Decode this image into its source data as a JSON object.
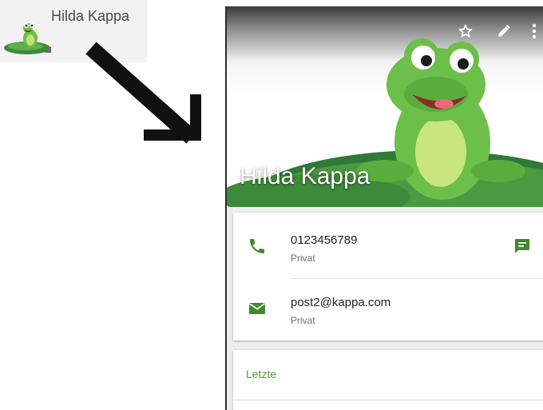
{
  "list_item": {
    "name": "Hilda Kappa",
    "avatar": "frog-avatar"
  },
  "annotation": {
    "arrow": "arrow-down-right-icon"
  },
  "contact": {
    "name": "Hilda Kappa",
    "toolbar": {
      "star": "star-outline-icon",
      "edit": "pencil-icon",
      "more": "more-vert-icon"
    },
    "phone": {
      "number": "0123456789",
      "label": "Privat",
      "icon": "phone-icon",
      "action_icon": "message-icon"
    },
    "email": {
      "address": "post2@kappa.com",
      "label": "Privat",
      "icon": "email-icon"
    },
    "recent": {
      "title": "Letzte"
    }
  },
  "colors": {
    "accent": "#5c9a2c",
    "icon_green": "#3f8a2a",
    "text_dark": "#222222",
    "text_muted": "#6f6f6f"
  }
}
